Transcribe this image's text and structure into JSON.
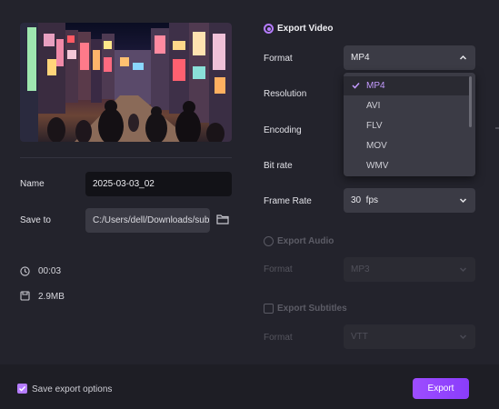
{
  "preview": {
    "icon": "street-scene-thumbnail"
  },
  "file": {
    "name_label": "Name",
    "name_value": "2025-03-03_02",
    "save_label": "Save to",
    "save_path": "C:/Users/dell/Downloads/sub",
    "duration": "00:03",
    "size": "2.9MB"
  },
  "video": {
    "title": "Export Video",
    "format_label": "Format",
    "format_value": "MP4",
    "format_options": [
      "MP4",
      "AVI",
      "FLV",
      "MOV",
      "WMV"
    ],
    "resolution_label": "Resolution",
    "encoding_label": "Encoding",
    "bitrate_label": "Bit rate",
    "framerate_label": "Frame Rate",
    "framerate_value": "30  fps"
  },
  "audio": {
    "title": "Export Audio",
    "format_label": "Format",
    "format_value": "MP3"
  },
  "subtitles": {
    "title": "Export Subtitles",
    "format_label": "Format",
    "format_value": "VTT"
  },
  "footer": {
    "save_options_label": "Save export options",
    "export_label": "Export"
  },
  "colors": {
    "accent": "#9d4dff",
    "background": "#23232c"
  }
}
